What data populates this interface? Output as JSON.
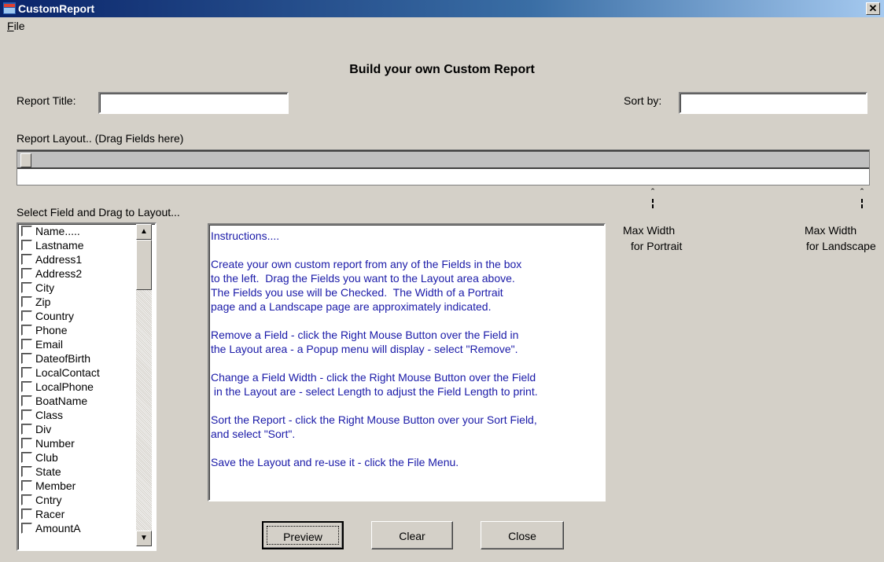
{
  "window": {
    "title": "CustomReport"
  },
  "menu": {
    "file": "File"
  },
  "heading": "Build your own Custom Report",
  "report_title": {
    "label": "Report Title:",
    "value": ""
  },
  "sort_by": {
    "label": "Sort by:",
    "value": ""
  },
  "layout_label": "Report Layout.. (Drag Fields here)",
  "select_label": "Select Field and Drag to Layout...",
  "markers": {
    "portrait": [
      "Max Width",
      "for Portrait"
    ],
    "landscape": [
      "Max Width",
      "for Landscape"
    ]
  },
  "fields": [
    "Name.....",
    "Lastname",
    "Address1",
    "Address2",
    "City",
    "Zip",
    "Country",
    "Phone",
    "Email",
    "DateofBirth",
    "LocalContact",
    "LocalPhone",
    "BoatName",
    "Class",
    "Div",
    "Number",
    "Club",
    "State",
    "Member",
    "Cntry",
    "Racer",
    "AmountA"
  ],
  "instructions": "Instructions....\n\nCreate your own custom report from any of the Fields in the box\nto the left.  Drag the Fields you want to the Layout area above.\nThe Fields you use will be Checked.  The Width of a Portrait\npage and a Landscape page are approximately indicated.\n\nRemove a Field - click the Right Mouse Button over the Field in\nthe Layout area - a Popup menu will display - select \"Remove\".\n\nChange a Field Width - click the Right Mouse Button over the Field\n in the Layout are - select Length to adjust the Field Length to print.\n\nSort the Report - click the Right Mouse Button over your Sort Field,\nand select \"Sort\".\n\nSave the Layout and re-use it - click the File Menu.",
  "buttons": {
    "preview": "Preview",
    "clear": "Clear",
    "close": "Close"
  },
  "icons": {
    "app": "app-icon",
    "close": "close-icon"
  }
}
